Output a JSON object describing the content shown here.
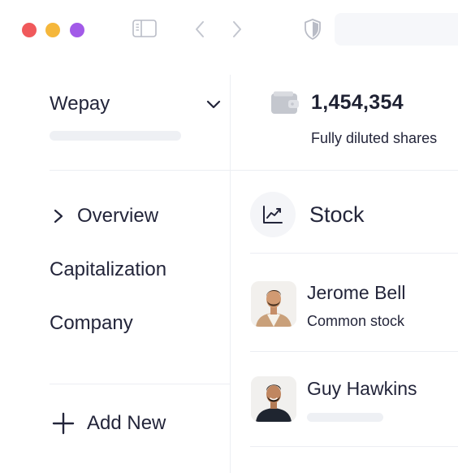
{
  "window": {
    "controls": [
      "close",
      "minimize",
      "zoom"
    ],
    "colors": {
      "close": "#f0595b",
      "minimize": "#f5b73b",
      "zoom": "#a25ae8"
    },
    "toolbar_icons": [
      "sidebar-toggle-icon",
      "back-icon",
      "forward-icon",
      "shield-icon"
    ]
  },
  "sidebar": {
    "company": {
      "name": "Wepay",
      "icon": "chevron-down-icon"
    },
    "nav": [
      {
        "label": "Overview",
        "icon": "chevron-right-icon"
      },
      {
        "label": "Capitalization"
      },
      {
        "label": "Company"
      }
    ],
    "add_new": {
      "label": "Add New",
      "icon": "plus-icon"
    }
  },
  "summary": {
    "icon": "wallet-icon",
    "value": "1,454,354",
    "label": "Fully diluted shares"
  },
  "stock_section": {
    "icon": "line-chart-icon",
    "title": "Stock"
  },
  "holders": [
    {
      "name": "Jerome Bell",
      "type": "Common stock",
      "avatar": "avatar-jerome"
    },
    {
      "name": "Guy Hawkins",
      "avatar": "avatar-guy"
    }
  ]
}
